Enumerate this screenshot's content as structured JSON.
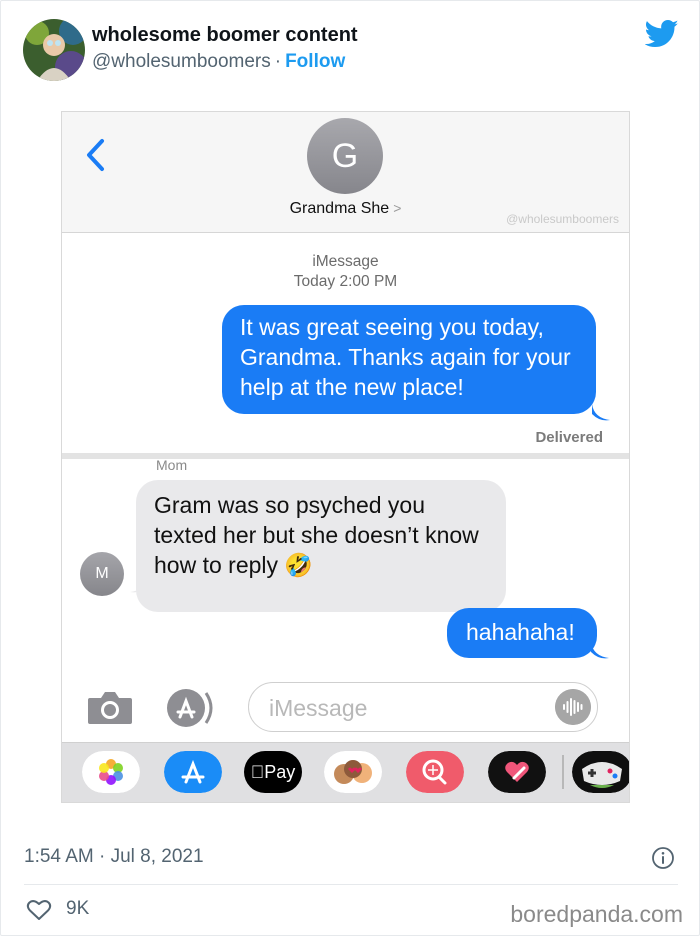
{
  "tweet": {
    "author_name": "wholesome boomer content",
    "handle": "@wholesumboomers",
    "separator": "·",
    "follow_label": "Follow",
    "timestamp": "1:54 AM · Jul 8, 2021",
    "like_count": "9K",
    "source_watermark": "boredpanda.com"
  },
  "imessage": {
    "contact_initial": "G",
    "contact_name": "Grandma She",
    "contact_chevron": ">",
    "watermark": "@wholesumboomers",
    "service_label": "iMessage",
    "time_label": "Today 2:00 PM",
    "messages": [
      {
        "text": "It was great seeing you today, Grandma. Thanks again for your help at the new place!"
      },
      {
        "sender": "Mom",
        "sender_initial": "M",
        "text": "Gram was so psyched you texted her but she doesn’t know how to reply 🤣"
      },
      {
        "text": "hahahaha!"
      }
    ],
    "delivered_label": "Delivered",
    "input_placeholder": "iMessage",
    "apple_pay_label": "Pay"
  },
  "colors": {
    "bubble_blue": "#1a7cf5",
    "bubble_gray": "#e9e9eb",
    "twitter_blue": "#1d9bf0"
  }
}
